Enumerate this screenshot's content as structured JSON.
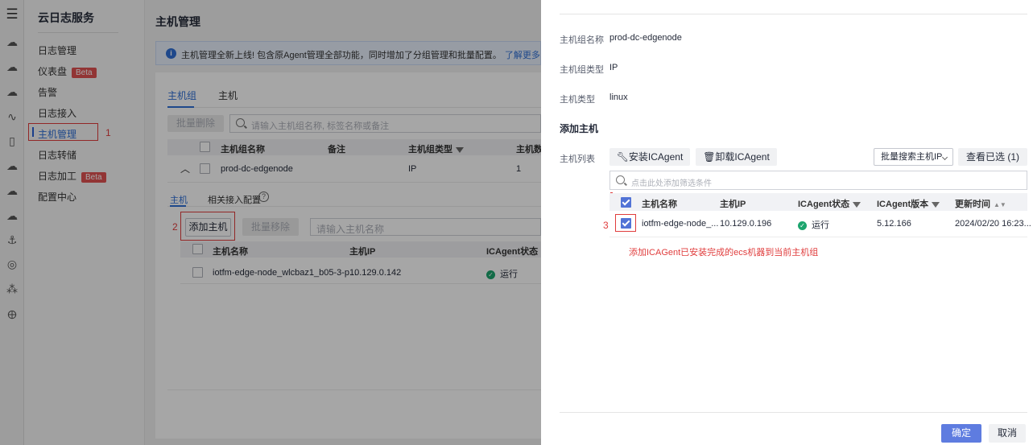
{
  "rail": {
    "icons": [
      "menu-icon",
      "cloud-icon",
      "cloud-chat-icon",
      "cloud-storage-icon",
      "chart-wave-icon",
      "phone-icon",
      "cloud-outline-icon",
      "cloud-up-icon",
      "cloud-down-icon",
      "anchor-icon",
      "coin-icon",
      "cluster-icon",
      "globe-icon"
    ]
  },
  "nav": {
    "title": "云日志服务",
    "items": [
      {
        "label": "日志管理"
      },
      {
        "label": "仪表盘",
        "badge": "Beta"
      },
      {
        "label": "告警"
      },
      {
        "label": "日志接入"
      },
      {
        "label": "主机管理"
      },
      {
        "label": "日志转储"
      },
      {
        "label": "日志加工",
        "badge": "Beta"
      },
      {
        "label": "配置中心"
      }
    ],
    "annotation": "1"
  },
  "main": {
    "title": "主机管理",
    "info": "主机管理全新上线! 包含原Agent管理全部功能，同时增加了分组管理和批量配置。",
    "info_link": "了解更多",
    "tabs": [
      "主机组",
      "主机"
    ],
    "batch_delete": "批量删除",
    "search_placeholder": "请输入主机组名称, 标签名称或备注",
    "group_table": {
      "headers": [
        "主机组名称",
        "备注",
        "主机组类型",
        "主机数"
      ],
      "row": {
        "name": "prod-dc-edgenode",
        "remark": "",
        "type": "IP",
        "count": "1"
      }
    },
    "sub_tabs": [
      "主机",
      "相关接入配置"
    ],
    "help_icon": "?",
    "add_host": "添加主机",
    "batch_remove": "批量移除",
    "host_search_placeholder": "请输入主机名称",
    "annotation": "2",
    "host_table": {
      "headers": [
        "主机名称",
        "主机IP",
        "ICAgent状态"
      ],
      "row": {
        "name": "iotfm-edge-node_wlcbaz1_b05-3-p...",
        "ip": "10.129.0.142",
        "status": "运行"
      }
    }
  },
  "drawer": {
    "fields": [
      {
        "label": "主机组名称",
        "value": "prod-dc-edgenode"
      },
      {
        "label": "主机组类型",
        "value": "IP"
      },
      {
        "label": "主机类型",
        "value": "linux"
      }
    ],
    "section": "添加主机",
    "host_list_label": "主机列表",
    "install_btn": "安装ICAgent",
    "uninstall_btn": "卸载ICAgent",
    "batch_search": "批量搜索主机IP",
    "view_selected": "查看已选 (1)",
    "filter_placeholder": "点击此处添加筛选条件",
    "table": {
      "headers": [
        "主机名称",
        "主机IP",
        "ICAgent状态",
        "ICAgent版本",
        "更新时间"
      ],
      "row": {
        "name": "iotfm-edge-node_...",
        "ip": "10.129.0.196",
        "status": "运行",
        "version": "5.12.166",
        "time": "2024/02/20 16:23..."
      }
    },
    "annotation": "3",
    "annotation_note": "添加ICAGent已安装完成的ecs机器到当前主机组",
    "confirm": "确定",
    "cancel": "取消"
  },
  "colors": {
    "accent": "#5e7ce0",
    "link": "#2f6fd6",
    "annotation": "#e03d3d",
    "status_ok": "#1da56e",
    "badge": "#e05252"
  }
}
